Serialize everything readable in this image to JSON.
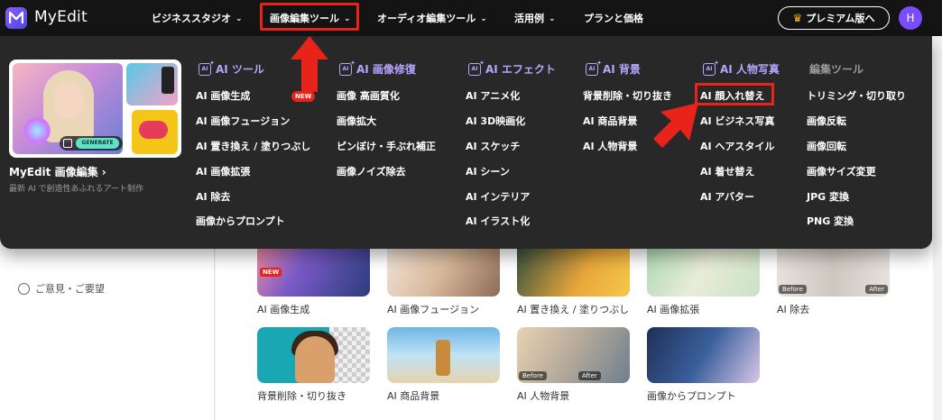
{
  "brand": {
    "name": "MyEdit"
  },
  "topnav": {
    "items": [
      {
        "label": "ビジネススタジオ",
        "chevron": "chevron-down-icon"
      },
      {
        "label": "画像編集ツール",
        "chevron": "chevron-down-icon"
      },
      {
        "label": "オーディオ編集ツール",
        "chevron": "chevron-down-icon"
      },
      {
        "label": "活用例",
        "chevron": "chevron-down-icon"
      },
      {
        "label": "プランと価格"
      }
    ],
    "premium_label": "プレミアム版へ",
    "avatar_initial": "H"
  },
  "mega_menu": {
    "promo": {
      "title": "MyEdit 画像編集 ›",
      "subtitle": "最新 AI で創造性あふれるアート制作",
      "generate_label": "GENERATE"
    },
    "columns": [
      {
        "heading": "AI ツール",
        "items": [
          "AI 画像生成",
          "AI 画像フュージョン",
          "AI 置き換え / 塗りつぶし",
          "AI 画像拡張",
          "AI 除去",
          "画像からプロンプト"
        ]
      },
      {
        "heading": "AI 画像修復",
        "items": [
          "画像 高画質化",
          "画像拡大",
          "ピンぼけ・手ぶれ補正",
          "画像ノイズ除去"
        ]
      },
      {
        "heading": "AI エフェクト",
        "items": [
          "AI アニメ化",
          "AI 3D映画化",
          "AI スケッチ",
          "AI シーン",
          "AI インテリア",
          "AI イラスト化"
        ]
      },
      {
        "heading": "AI 背景",
        "items": [
          "背景削除・切り抜き",
          "AI 商品背景",
          "AI 人物背景"
        ]
      },
      {
        "heading": "AI 人物写真",
        "items": [
          "AI 顔入れ替え",
          "AI ビジネス写真",
          "AI ヘアスタイル",
          "AI 着せ替え",
          "AI アバター"
        ]
      },
      {
        "heading": "編集ツール",
        "items": [
          "トリミング・切り取り",
          "画像反転",
          "画像回転",
          "画像サイズ変更",
          "JPG 変換",
          "PNG 変換"
        ]
      }
    ],
    "new_badge": "NEW"
  },
  "sidebar": {
    "feedback_label": "ご意見・ご要望"
  },
  "cards": {
    "row1": [
      "AI 画像生成",
      "AI 画像フュージョン",
      "AI 置き換え / 塗りつぶし",
      "AI 画像拡張",
      "AI 除去"
    ],
    "row2": [
      "背景削除・切り抜き",
      "AI 商品背景",
      "AI 人物背景",
      "画像からプロンプト"
    ],
    "before_label": "Before",
    "after_label": "After",
    "new_label": "NEW"
  },
  "colors": {
    "highlight": "#e8241a",
    "accent": "#b7a4ff",
    "nav_bg": "#141414",
    "menu_bg": "#282828"
  }
}
